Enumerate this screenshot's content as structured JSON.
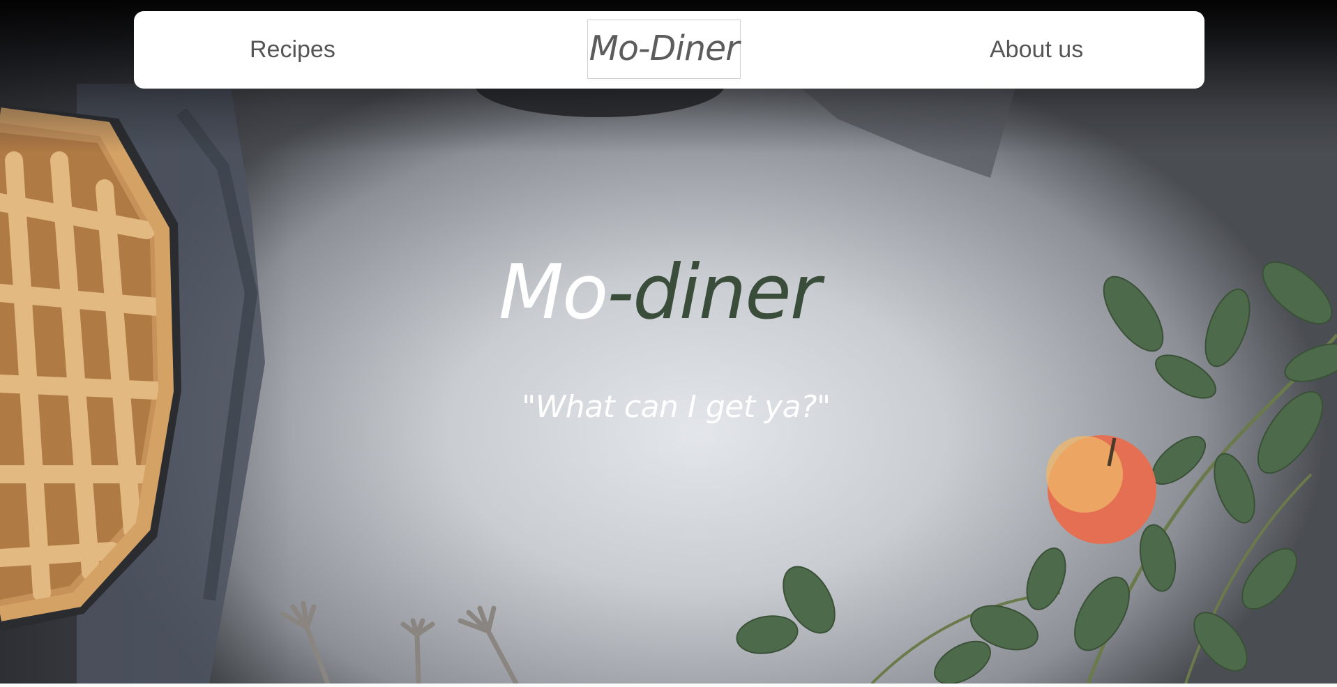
{
  "nav": {
    "recipes_label": "Recipes",
    "logo_text": "Mo-Diner",
    "about_label": "About us"
  },
  "hero": {
    "title_part1": "Mo",
    "title_part2": "-diner",
    "tagline": "\"What can I get ya?\""
  },
  "colors": {
    "title_accent": "#3a4d3a",
    "nav_text": "#555555",
    "nav_background": "#ffffff"
  },
  "background": {
    "icon": "food-table-photo",
    "elements": [
      "lattice-pie",
      "linen-towel",
      "apple",
      "eucalyptus-branches",
      "forks",
      "concrete-surface"
    ]
  }
}
